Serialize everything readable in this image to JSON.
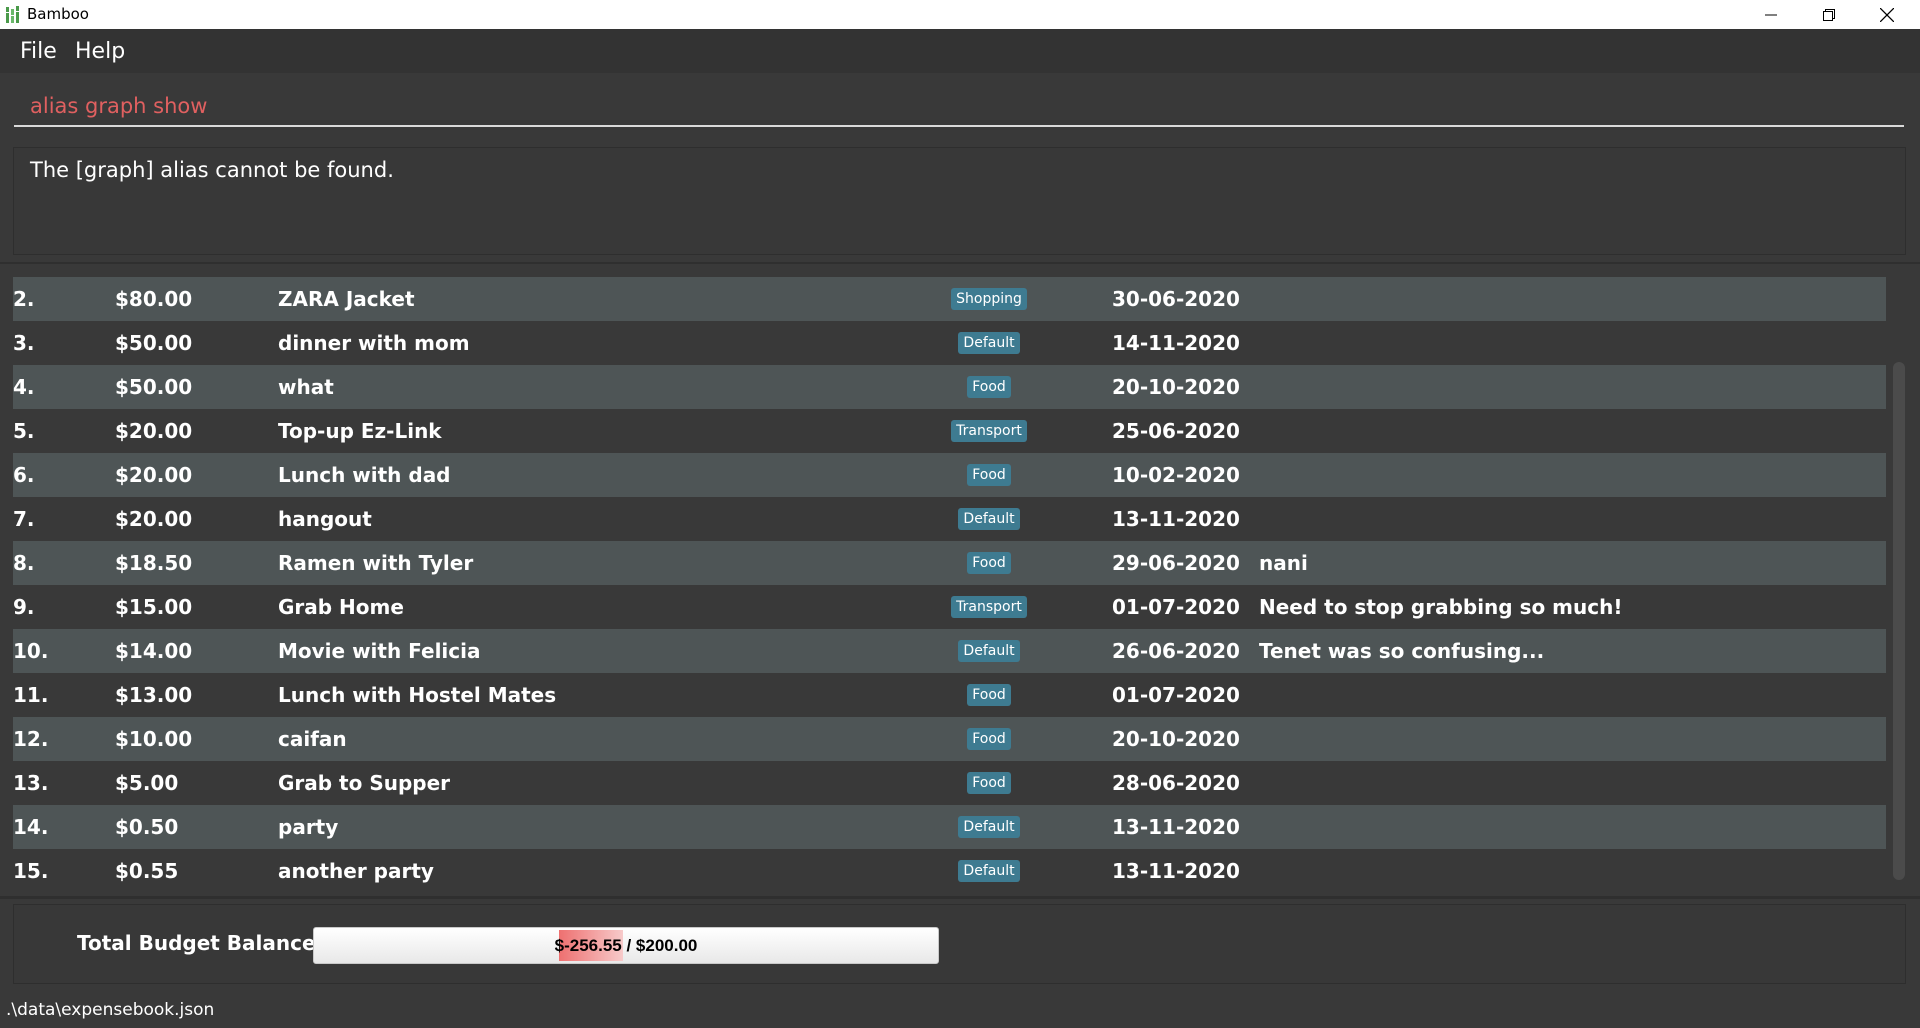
{
  "window": {
    "title": "Bamboo"
  },
  "menu": {
    "file": "File",
    "help": "Help"
  },
  "command": {
    "value": "alias graph show"
  },
  "result": {
    "message": "The [graph] alias cannot be found."
  },
  "expenses": [
    {
      "index": "2.",
      "amount": "$80.00",
      "description": "ZARA Jacket",
      "tag": "Shopping",
      "date": "30-06-2020",
      "remark": ""
    },
    {
      "index": "3.",
      "amount": "$50.00",
      "description": "dinner with mom",
      "tag": "Default",
      "date": "14-11-2020",
      "remark": ""
    },
    {
      "index": "4.",
      "amount": "$50.00",
      "description": "what",
      "tag": "Food",
      "date": "20-10-2020",
      "remark": ""
    },
    {
      "index": "5.",
      "amount": "$20.00",
      "description": "Top-up Ez-Link",
      "tag": "Transport",
      "date": "25-06-2020",
      "remark": ""
    },
    {
      "index": "6.",
      "amount": "$20.00",
      "description": "Lunch with dad",
      "tag": "Food",
      "date": "10-02-2020",
      "remark": ""
    },
    {
      "index": "7.",
      "amount": "$20.00",
      "description": "hangout",
      "tag": "Default",
      "date": "13-11-2020",
      "remark": ""
    },
    {
      "index": "8.",
      "amount": "$18.50",
      "description": "Ramen with Tyler",
      "tag": "Food",
      "date": "29-06-2020",
      "remark": "nani"
    },
    {
      "index": "9.",
      "amount": "$15.00",
      "description": "Grab Home",
      "tag": "Transport",
      "date": "01-07-2020",
      "remark": "Need to stop grabbing so much!"
    },
    {
      "index": "10.",
      "amount": "$14.00",
      "description": "Movie with Felicia",
      "tag": "Default",
      "date": "26-06-2020",
      "remark": "Tenet was so confusing..."
    },
    {
      "index": "11.",
      "amount": "$13.00",
      "description": "Lunch with Hostel Mates",
      "tag": "Food",
      "date": "01-07-2020",
      "remark": ""
    },
    {
      "index": "12.",
      "amount": "$10.00",
      "description": "caifan",
      "tag": "Food",
      "date": "20-10-2020",
      "remark": ""
    },
    {
      "index": "13.",
      "amount": "$5.00",
      "description": "Grab to Supper",
      "tag": "Food",
      "date": "28-06-2020",
      "remark": ""
    },
    {
      "index": "14.",
      "amount": "$0.50",
      "description": "party",
      "tag": "Default",
      "date": "13-11-2020",
      "remark": ""
    },
    {
      "index": "15.",
      "amount": "$0.55",
      "description": "another party",
      "tag": "Default",
      "date": "13-11-2020",
      "remark": ""
    }
  ],
  "budget": {
    "label": "Total Budget Balance:",
    "display": "$-256.55 / $200.00"
  },
  "status": {
    "path": ".\\data\\expensebook.json"
  },
  "colors": {
    "row_light": "#4e5556",
    "row_dark": "#393939",
    "tag_bg": "#3e7b91",
    "command_text": "#e06060"
  }
}
